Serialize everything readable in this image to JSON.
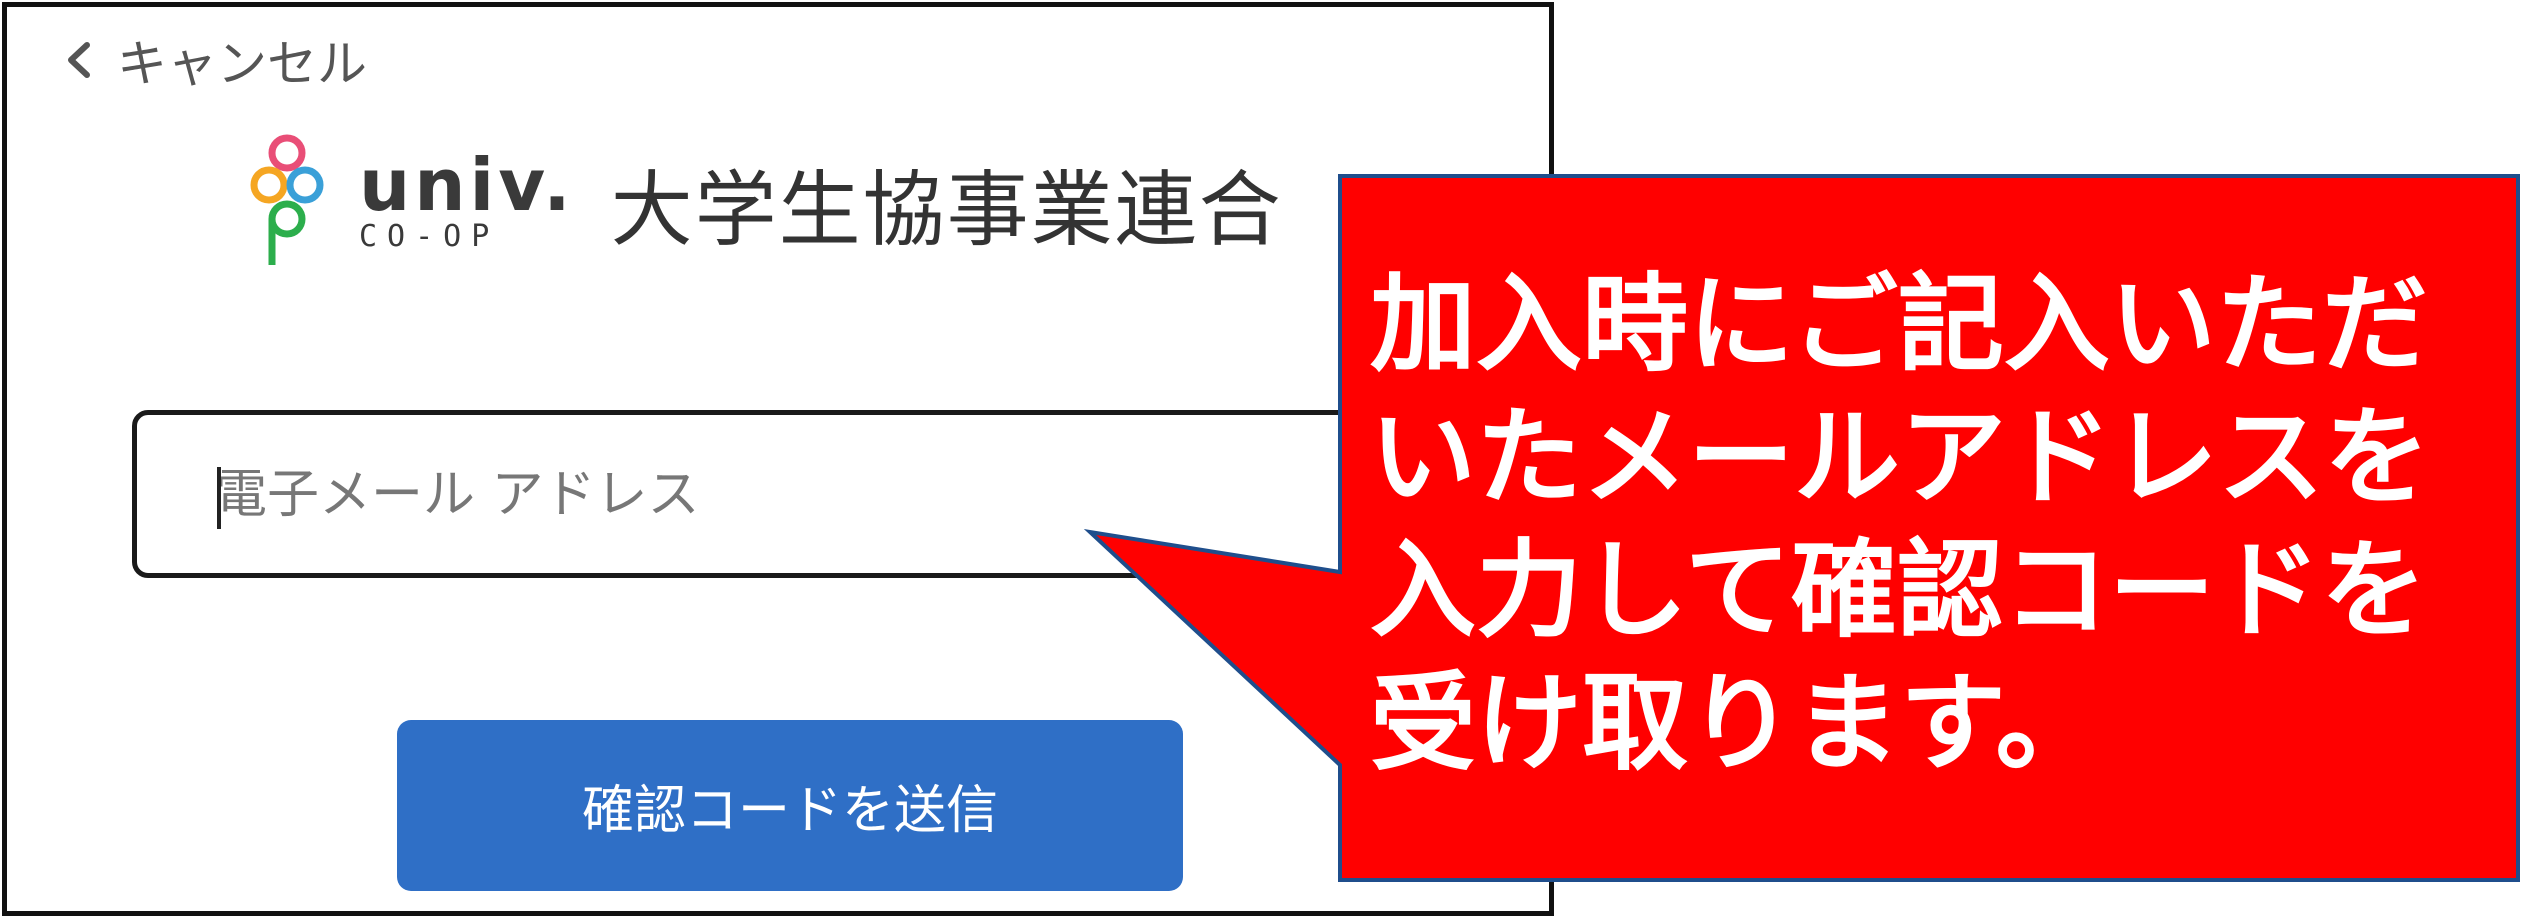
{
  "header": {
    "cancel_label": "キャンセル"
  },
  "logo": {
    "univ": "univ.",
    "coop": "CO-OP",
    "organization": "大学生協事業連合",
    "ring_colors": [
      "#e94e77",
      "#f5a623",
      "#3aa0d8",
      "#2cae4c"
    ]
  },
  "form": {
    "email_placeholder": "電子メール アドレス",
    "email_value": "",
    "send_button_label": "確認コードを送信"
  },
  "callout": {
    "lines": [
      "加入時にご記入いただ",
      "いたメールアドレスを",
      "入力して確認コードを",
      "受け取ります。"
    ],
    "fill_color": "#ff0000",
    "border_color": "#1f4e8c"
  }
}
